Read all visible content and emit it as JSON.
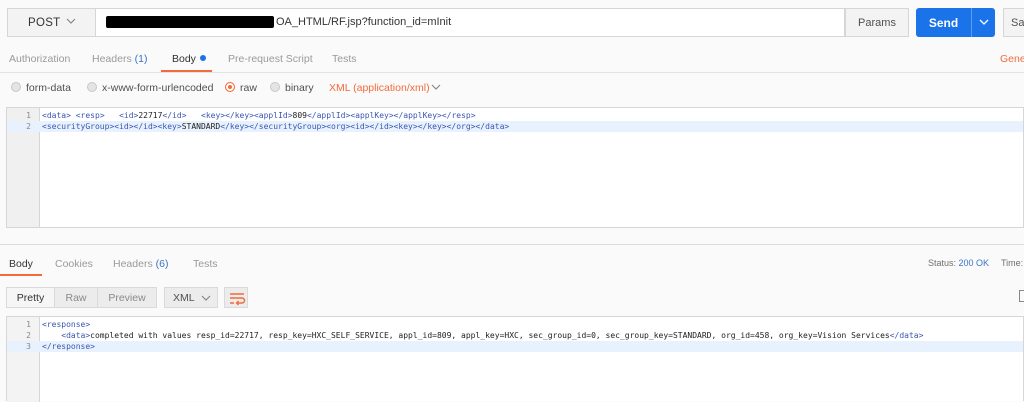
{
  "request": {
    "method": "POST",
    "url_visible": "OA_HTML/RF.jsp?function_id=mInit",
    "params_label": "Params",
    "send_label": "Send",
    "save_label_partial": "Sa"
  },
  "request_tabs": [
    {
      "label": "Authorization",
      "count": ""
    },
    {
      "label": "Headers",
      "count": "(1)"
    },
    {
      "label": "Body",
      "count": ""
    },
    {
      "label": "Pre-request Script",
      "count": ""
    },
    {
      "label": "Tests",
      "count": ""
    }
  ],
  "generate_partial": "Gene",
  "body_options": {
    "form_data": "form-data",
    "urlencoded": "x-www-form-urlencoded",
    "raw": "raw",
    "binary": "binary",
    "content_type": "XML (application/xml)"
  },
  "request_body": {
    "line_numbers": [
      "1",
      "2"
    ]
  },
  "response_tabs": [
    {
      "label": "Body",
      "count": ""
    },
    {
      "label": "Cookies",
      "count": ""
    },
    {
      "label": "Headers",
      "count": "(6)"
    },
    {
      "label": "Tests",
      "count": ""
    }
  ],
  "response_meta": {
    "status_label": "Status:",
    "status_value": "200 OK",
    "time_label": "Time:"
  },
  "view_modes": [
    "Pretty",
    "Raw",
    "Preview"
  ],
  "format": "XML",
  "response_body": {
    "line_numbers": [
      "1",
      "2",
      "3"
    ],
    "data_text": "completed with values resp_id=22717, resp_key=HXC_SELF_SERVICE, appl_id=809, appl_key=HXC, sec_group_id=0, sec_group_key=STANDARD, org_id=458, org_key=Vision Services"
  },
  "colors": {
    "accent_orange": "#f26b3a",
    "send_blue": "#1a73e8",
    "tag_blue": "#3a56b0"
  }
}
